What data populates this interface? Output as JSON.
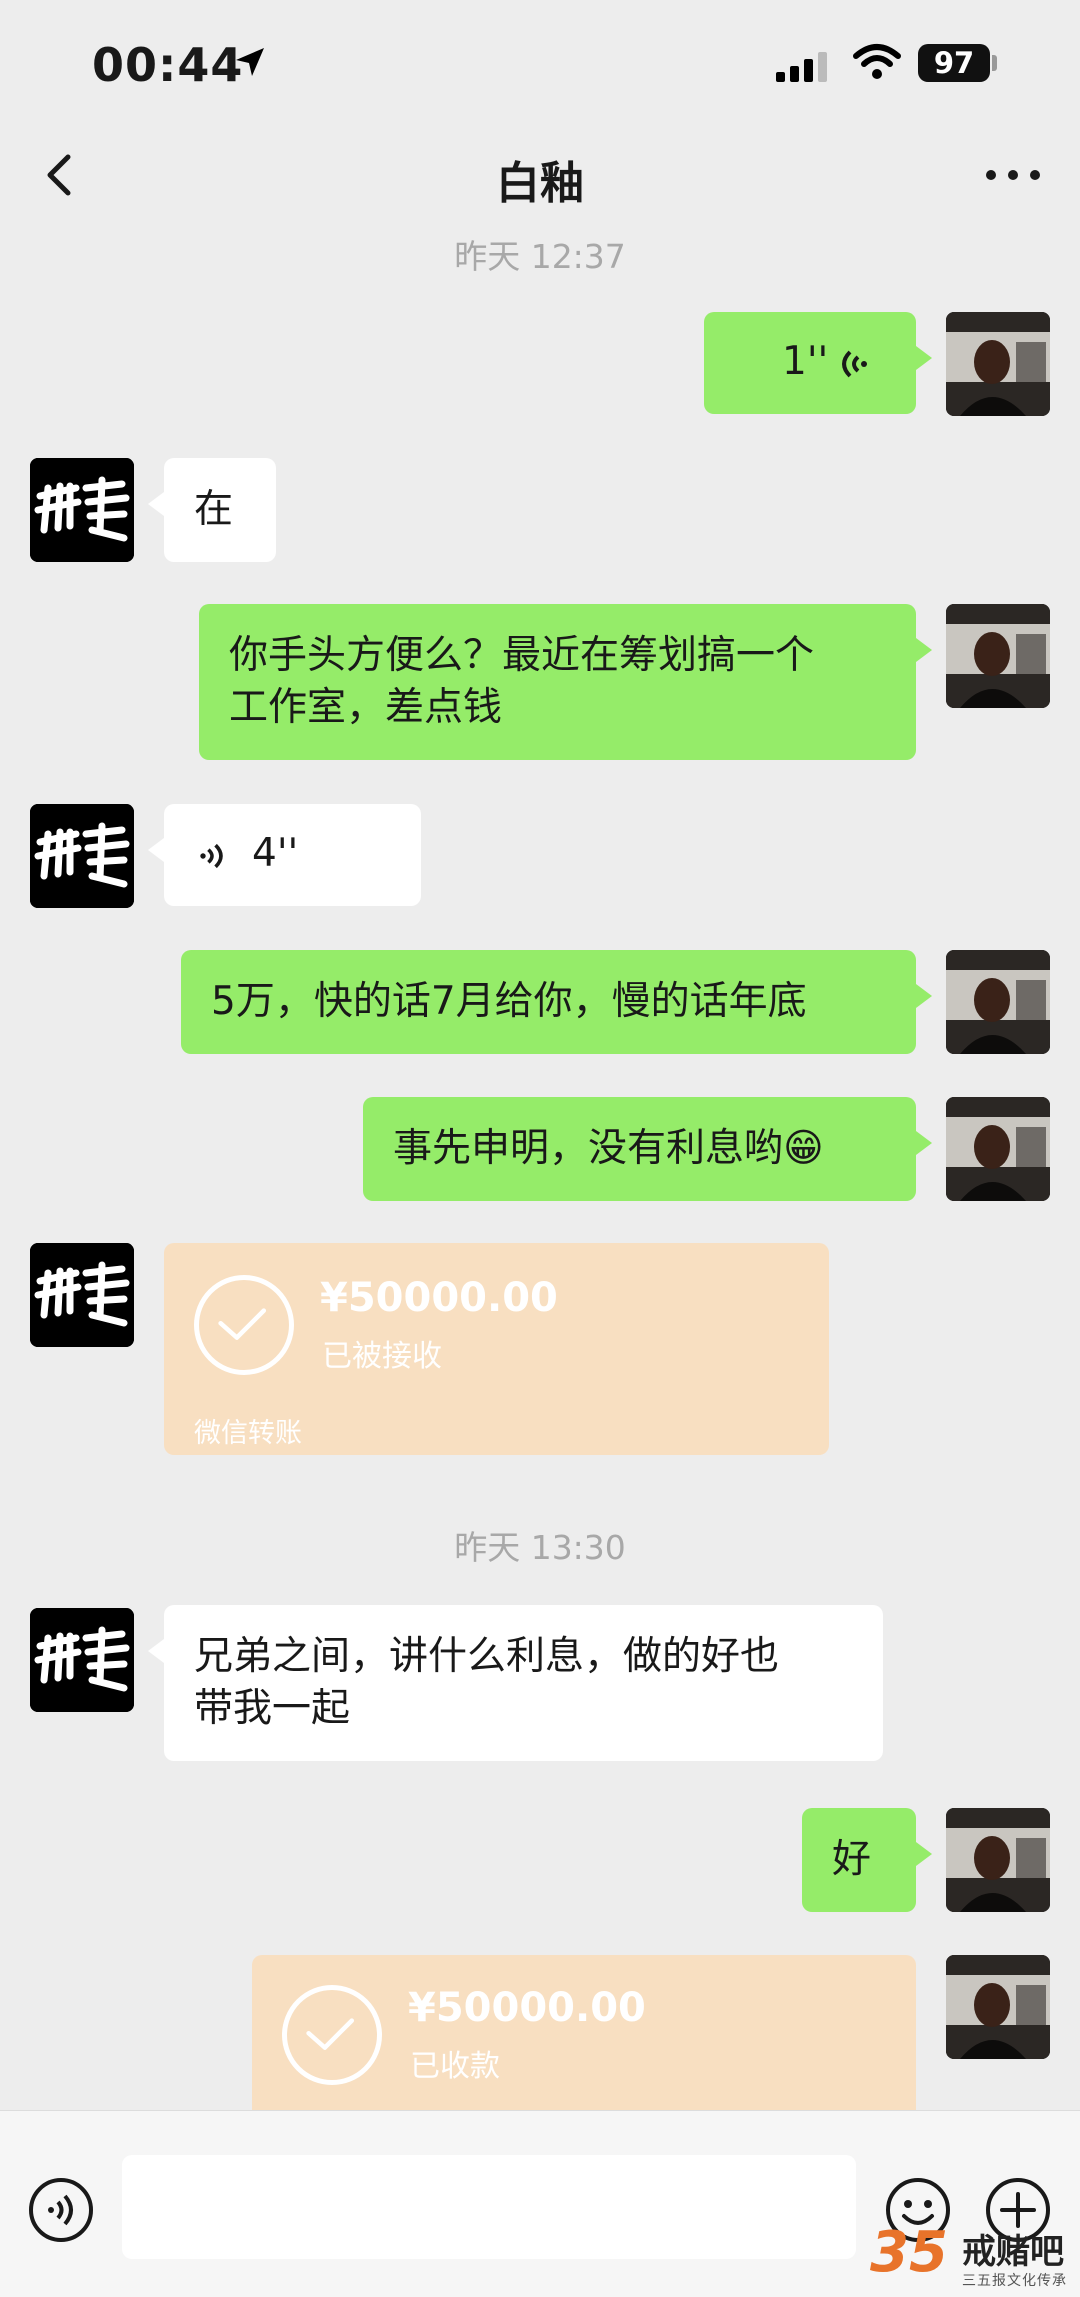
{
  "status_bar": {
    "time": "00:44",
    "battery": "97"
  },
  "header": {
    "title": "白釉"
  },
  "messages": {
    "ts1": "昨天 12:37",
    "m1_voice": "1''",
    "m2_text": "在",
    "m3_line1": "你手头方便么？最近在筹划搞一个",
    "m3_line2": "工作室，差点钱",
    "m4_voice": "4''",
    "m5_text": "5万，快的话7月给你，慢的话年底",
    "m6_text": "事先申明，没有利息哟😁",
    "t1_amount": "¥50000.00",
    "t1_status": "已被接收",
    "t1_footer": "微信转账",
    "ts2": "昨天 13:30",
    "m7_line1": "兄弟之间，讲什么利息，做的好也",
    "m7_line2": "带我一起",
    "m8_text": "好",
    "t2_amount": "¥50000.00",
    "t2_status": "已收款"
  },
  "watermark": {
    "logo": "35",
    "brand": "戒赌吧",
    "slogan": "三五报文化传承"
  },
  "colors": {
    "bubble_me": "#95ec69",
    "bubble_other": "#ffffff",
    "transfer_bg": "#f8dfc1",
    "background": "#ededed"
  }
}
